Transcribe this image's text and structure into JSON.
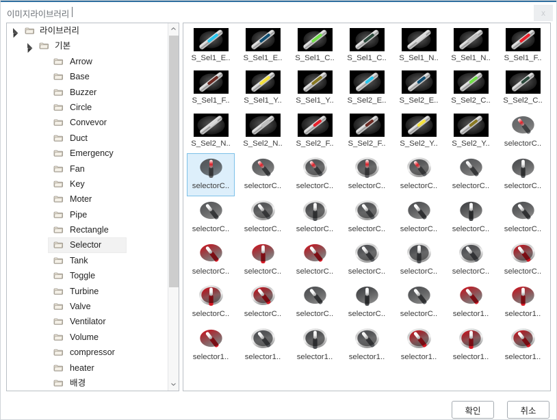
{
  "window": {
    "title": "이미지라이브러리",
    "close_icon": "close-icon",
    "close_label": "x"
  },
  "tree": {
    "scroll_up_icon": "chevron-up-icon",
    "scroll_down_icon": "chevron-down-icon",
    "items": [
      {
        "label": "라이브러리",
        "level": 0,
        "expanded": true,
        "selected": false
      },
      {
        "label": "기본",
        "level": 1,
        "expanded": true,
        "selected": false
      },
      {
        "label": "Arrow",
        "level": 2,
        "expanded": null,
        "selected": false
      },
      {
        "label": "Base",
        "level": 2,
        "expanded": null,
        "selected": false
      },
      {
        "label": "Buzzer",
        "level": 2,
        "expanded": null,
        "selected": false
      },
      {
        "label": "Circle",
        "level": 2,
        "expanded": null,
        "selected": false
      },
      {
        "label": "Convevor",
        "level": 2,
        "expanded": null,
        "selected": false
      },
      {
        "label": "Duct",
        "level": 2,
        "expanded": null,
        "selected": false
      },
      {
        "label": "Emergency",
        "level": 2,
        "expanded": null,
        "selected": false
      },
      {
        "label": "Fan",
        "level": 2,
        "expanded": null,
        "selected": false
      },
      {
        "label": "Key",
        "level": 2,
        "expanded": null,
        "selected": false
      },
      {
        "label": "Moter",
        "level": 2,
        "expanded": null,
        "selected": false
      },
      {
        "label": "Pipe",
        "level": 2,
        "expanded": null,
        "selected": false
      },
      {
        "label": "Rectangle",
        "level": 2,
        "expanded": null,
        "selected": false
      },
      {
        "label": "Selector",
        "level": 2,
        "expanded": null,
        "selected": true
      },
      {
        "label": "Tank",
        "level": 2,
        "expanded": null,
        "selected": false
      },
      {
        "label": "Toggle",
        "level": 2,
        "expanded": null,
        "selected": false
      },
      {
        "label": "Turbine",
        "level": 2,
        "expanded": null,
        "selected": false
      },
      {
        "label": "Valve",
        "level": 2,
        "expanded": null,
        "selected": false
      },
      {
        "label": "Ventilator",
        "level": 2,
        "expanded": null,
        "selected": false
      },
      {
        "label": "Volume",
        "level": 2,
        "expanded": null,
        "selected": false
      },
      {
        "label": "compressor",
        "level": 2,
        "expanded": null,
        "selected": false
      },
      {
        "label": "heater",
        "level": 2,
        "expanded": null,
        "selected": false
      },
      {
        "label": "배경",
        "level": 2,
        "expanded": null,
        "selected": false
      }
    ]
  },
  "grid": {
    "items": [
      {
        "label": "S_Sel1_E..",
        "style": "knob1",
        "bg": "black",
        "accent": "#29c7ef",
        "angle": -38,
        "selected": false
      },
      {
        "label": "S_Sel1_E..",
        "style": "knob1",
        "bg": "black",
        "accent": "#114f73",
        "angle": -38,
        "selected": false
      },
      {
        "label": "S_Sel1_C..",
        "style": "knob1",
        "bg": "black",
        "accent": "#73e04a",
        "angle": -38,
        "selected": false
      },
      {
        "label": "S_Sel1_C..",
        "style": "knob1",
        "bg": "black",
        "accent": "#2c4a3c",
        "angle": -38,
        "selected": false
      },
      {
        "label": "S_Sel1_N..",
        "style": "knob1",
        "bg": "black",
        "accent": "#d8d8d8",
        "angle": -38,
        "selected": false
      },
      {
        "label": "S_Sel1_N..",
        "style": "knob1",
        "bg": "black",
        "accent": "#bdbdbd",
        "angle": -38,
        "selected": false
      },
      {
        "label": "S_Sel1_F..",
        "style": "knob1",
        "bg": "black",
        "accent": "#e8212b",
        "angle": -38,
        "selected": false
      },
      {
        "label": "S_Sel1_F..",
        "style": "knob1",
        "bg": "black",
        "accent": "#6d2b24",
        "angle": -38,
        "selected": false
      },
      {
        "label": "S_Sel1_Y..",
        "style": "knob1",
        "bg": "black",
        "accent": "#f5e23c",
        "angle": -38,
        "selected": false
      },
      {
        "label": "S_Sel1_Y..",
        "style": "knob1",
        "bg": "black",
        "accent": "#8a7a23",
        "angle": -38,
        "selected": false
      },
      {
        "label": "S_Sel2_E..",
        "style": "knob2",
        "bg": "black",
        "accent": "#29c7ef",
        "angle": -38,
        "selected": false
      },
      {
        "label": "S_Sel2_E..",
        "style": "knob2",
        "bg": "black",
        "accent": "#114f73",
        "angle": -38,
        "selected": false
      },
      {
        "label": "S_Sel2_C..",
        "style": "knob2",
        "bg": "black",
        "accent": "#73e04a",
        "angle": -38,
        "selected": false
      },
      {
        "label": "S_Sel2_C..",
        "style": "knob2",
        "bg": "black",
        "accent": "#2c4a3c",
        "angle": -38,
        "selected": false
      },
      {
        "label": "S_Sel2_N..",
        "style": "knob2",
        "bg": "black",
        "accent": "#d8d8d8",
        "angle": -38,
        "selected": false
      },
      {
        "label": "S_Sel2_N..",
        "style": "knob2",
        "bg": "black",
        "accent": "#bdbdbd",
        "angle": -38,
        "selected": false
      },
      {
        "label": "S_Sel2_F..",
        "style": "knob2",
        "bg": "black",
        "accent": "#e8212b",
        "angle": -38,
        "selected": false
      },
      {
        "label": "S_Sel2_F..",
        "style": "knob2",
        "bg": "black",
        "accent": "#6d2b24",
        "angle": -38,
        "selected": false
      },
      {
        "label": "S_Sel2_Y..",
        "style": "knob2",
        "bg": "black",
        "accent": "#f5e23c",
        "angle": -38,
        "selected": false
      },
      {
        "label": "S_Sel2_Y..",
        "style": "knob2",
        "bg": "black",
        "accent": "#8a7a23",
        "angle": -38,
        "selected": false
      },
      {
        "label": "selectorC..",
        "style": "dial",
        "bg": "none",
        "dial": "#6b6e71",
        "accent": "#e01d26",
        "angle": -38,
        "ring": false,
        "selected": false
      },
      {
        "label": "selectorC..",
        "style": "dial",
        "bg": "none",
        "dial": "#57595c",
        "accent": "#e01d26",
        "angle": 0,
        "ring": false,
        "selected": true
      },
      {
        "label": "selectorC..",
        "style": "dial",
        "bg": "none",
        "dial": "#5a5c5f",
        "accent": "#e01d26",
        "angle": -38,
        "ring": false,
        "selected": false
      },
      {
        "label": "selectorC..",
        "style": "dial",
        "bg": "none",
        "dial": "#5a5c5f",
        "accent": "#e01d26",
        "angle": -38,
        "ring": true,
        "selected": false
      },
      {
        "label": "selectorC..",
        "style": "dial",
        "bg": "none",
        "dial": "#57595c",
        "accent": "#e01d26",
        "angle": 0,
        "ring": true,
        "selected": false
      },
      {
        "label": "selectorC..",
        "style": "dial",
        "bg": "none",
        "dial": "#5a5c5f",
        "accent": "#e01d26",
        "angle": -38,
        "ring": true,
        "selected": false
      },
      {
        "label": "selectorC..",
        "style": "dial",
        "bg": "none",
        "dial": "#5a5c5f",
        "accent": "#e8e8e8",
        "angle": -38,
        "ring": false,
        "selected": false
      },
      {
        "label": "selectorC..",
        "style": "dial",
        "bg": "none",
        "dial": "#4c4e51",
        "accent": "#efefef",
        "angle": 0,
        "ring": false,
        "selected": false
      },
      {
        "label": "selectorC..",
        "style": "dial",
        "bg": "none",
        "dial": "#5a5c5f",
        "accent": "#efefef",
        "angle": -38,
        "ring": false,
        "selected": false
      },
      {
        "label": "selectorC..",
        "style": "dial",
        "bg": "none",
        "dial": "#5a5c5f",
        "accent": "#efefef",
        "angle": -38,
        "ring": true,
        "selected": false
      },
      {
        "label": "selectorC..",
        "style": "dial",
        "bg": "none",
        "dial": "#4c4e51",
        "accent": "#efefef",
        "angle": 0,
        "ring": true,
        "selected": false
      },
      {
        "label": "selectorC..",
        "style": "dial",
        "bg": "none",
        "dial": "#5a5c5f",
        "accent": "#efefef",
        "angle": -38,
        "ring": true,
        "selected": false
      },
      {
        "label": "selectorC..",
        "style": "dial",
        "bg": "none",
        "dial": "#4f5154",
        "accent": "#f2f2f2",
        "angle": -38,
        "ring": false,
        "selected": false
      },
      {
        "label": "selectorC..",
        "style": "dial",
        "bg": "none",
        "dial": "#3f4144",
        "accent": "#f5f5f5",
        "angle": 0,
        "ring": false,
        "selected": false
      },
      {
        "label": "selectorC..",
        "style": "dial",
        "bg": "none",
        "dial": "#4f5154",
        "accent": "#f2f2f2",
        "angle": -38,
        "ring": false,
        "selected": false
      },
      {
        "label": "selectorC..",
        "style": "dial",
        "bg": "none",
        "dial": "#d6101c",
        "accent": "#f4f4f4",
        "angle": -38,
        "ring": false,
        "selected": false
      },
      {
        "label": "selectorC..",
        "style": "dial",
        "bg": "none",
        "dial": "#d6101c",
        "accent": "#f4f4f4",
        "angle": 0,
        "ring": false,
        "selected": false
      },
      {
        "label": "selectorC..",
        "style": "dial",
        "bg": "none",
        "dial": "#d6101c",
        "accent": "#f4f4f4",
        "angle": -38,
        "ring": false,
        "selected": false
      },
      {
        "label": "selectorC..",
        "style": "dial",
        "bg": "none",
        "dial": "#53555a",
        "accent": "#e9e9e9",
        "angle": -38,
        "ring": true,
        "selected": false
      },
      {
        "label": "selectorC..",
        "style": "dial",
        "bg": "none",
        "dial": "#4a4c50",
        "accent": "#eeeeee",
        "angle": 0,
        "ring": true,
        "selected": false
      },
      {
        "label": "selectorC..",
        "style": "dial",
        "bg": "none",
        "dial": "#53555a",
        "accent": "#e9e9e9",
        "angle": -38,
        "ring": true,
        "selected": false
      },
      {
        "label": "selectorC..",
        "style": "dial",
        "bg": "none",
        "dial": "#d6101c",
        "accent": "#f4f4f4",
        "angle": -38,
        "ring": true,
        "selected": false
      },
      {
        "label": "selectorC..",
        "style": "dial",
        "bg": "none",
        "dial": "#d6101c",
        "accent": "#f4f4f4",
        "angle": 0,
        "ring": true,
        "selected": false
      },
      {
        "label": "selectorC..",
        "style": "dial",
        "bg": "none",
        "dial": "#d6101c",
        "accent": "#f4f4f4",
        "angle": -38,
        "ring": true,
        "selected": false
      },
      {
        "label": "selectorC..",
        "style": "dial",
        "bg": "none",
        "dial": "#4f5154",
        "accent": "#f2f2f2",
        "angle": -38,
        "ring": false,
        "selected": false
      },
      {
        "label": "selectorC..",
        "style": "dial",
        "bg": "none",
        "dial": "#3f4144",
        "accent": "#f5f5f5",
        "angle": 0,
        "ring": false,
        "selected": false
      },
      {
        "label": "selectorC..",
        "style": "dial",
        "bg": "none",
        "dial": "#4f5154",
        "accent": "#f2f2f2",
        "angle": -38,
        "ring": false,
        "selected": false
      },
      {
        "label": "selector1..",
        "style": "dial",
        "bg": "none",
        "dial": "#d6101c",
        "accent": "#f4f4f4",
        "angle": -38,
        "ring": false,
        "selected": false
      },
      {
        "label": "selector1..",
        "style": "dial",
        "bg": "none",
        "dial": "#d6101c",
        "accent": "#f4f4f4",
        "angle": 0,
        "ring": false,
        "selected": false
      },
      {
        "label": "selector1..",
        "style": "dial",
        "bg": "none",
        "dial": "#d6101c",
        "accent": "#f4f4f4",
        "angle": -38,
        "ring": false,
        "selected": false
      },
      {
        "label": "selector1..",
        "style": "dial",
        "bg": "none",
        "dial": "#53555a",
        "accent": "#e9e9e9",
        "angle": -38,
        "ring": true,
        "selected": false
      },
      {
        "label": "selector1..",
        "style": "dial",
        "bg": "none",
        "dial": "#4a4c50",
        "accent": "#eeeeee",
        "angle": 0,
        "ring": true,
        "selected": false
      },
      {
        "label": "selector1..",
        "style": "dial",
        "bg": "none",
        "dial": "#53555a",
        "accent": "#e9e9e9",
        "angle": -38,
        "ring": true,
        "selected": false
      },
      {
        "label": "selector1..",
        "style": "dial",
        "bg": "none",
        "dial": "#d6101c",
        "accent": "#f4f4f4",
        "angle": -38,
        "ring": true,
        "selected": false
      },
      {
        "label": "selector1..",
        "style": "dial",
        "bg": "none",
        "dial": "#d6101c",
        "accent": "#f4f4f4",
        "angle": 0,
        "ring": true,
        "selected": false
      },
      {
        "label": "selector1..",
        "style": "dial",
        "bg": "none",
        "dial": "#d6101c",
        "accent": "#f4f4f4",
        "angle": -38,
        "ring": true,
        "selected": false
      }
    ]
  },
  "footer": {
    "ok_label": "확인",
    "cancel_label": "취소"
  },
  "colors": {
    "accent_blue": "#2f6fa0",
    "selection_fill": "#ddeffb",
    "selection_border": "#7cc0e8"
  }
}
